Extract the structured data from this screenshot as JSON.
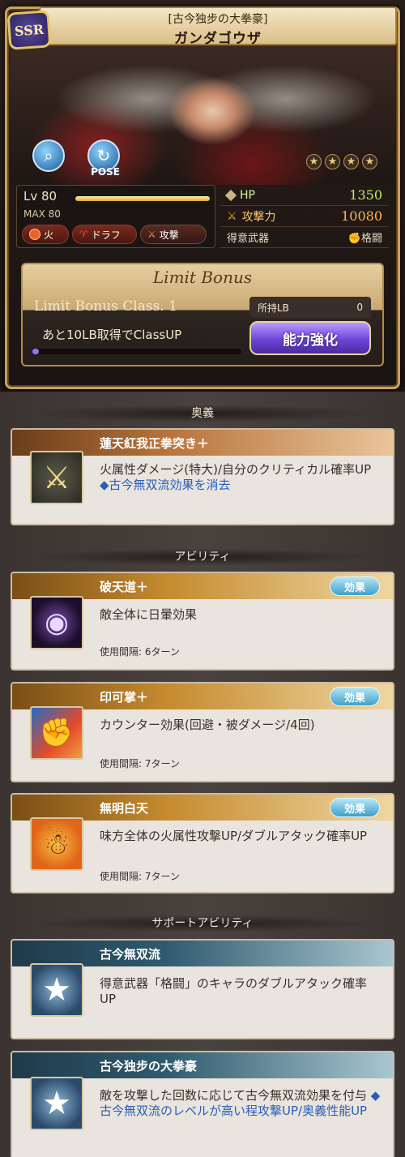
{
  "character": {
    "rarity": "SSR",
    "subtitle": "[古今独步の大拳豪]",
    "name": "ガンダゴウザ",
    "pose_label": "POSE",
    "stars": [
      "★",
      "★",
      "★",
      "★"
    ]
  },
  "level": {
    "label": "Lv 80",
    "max": "MAX 80",
    "element": "火",
    "race": "ドラフ",
    "type": "攻撃"
  },
  "stats": {
    "hp_label": "HP",
    "hp": "1350",
    "atk_label": "攻撃力",
    "atk": "10080",
    "weapon_label": "得意武器",
    "weapon": "格闘"
  },
  "limit_bonus": {
    "title": "Limit Bonus",
    "class": "Limit Bonus Class. 1",
    "owned_label": "所持LB",
    "owned": "0",
    "remaining": "あと10LB取得でClassUP",
    "button": "能力強化",
    "progress": 0.03
  },
  "sections": {
    "ougi": "奥義",
    "abilities": "アビリティ",
    "support": "サポートアビリティ"
  },
  "ougi": {
    "name": "蓮天紅我正拳突き＋",
    "desc": "火属性ダメージ(特大)/自分のクリティカル確率UP",
    "desc_blue": "◆古今無双流効果を消去"
  },
  "abilities": [
    {
      "name": "破天道＋",
      "effect_button": "効果",
      "desc": "敵全体に日暈効果",
      "cooldown": "使用間隔: 6ターン"
    },
    {
      "name": "印可掌＋",
      "effect_button": "効果",
      "desc": "カウンター効果(回避・被ダメージ/4回)",
      "cooldown": "使用間隔: 7ターン"
    },
    {
      "name": "無明白天",
      "effect_button": "効果",
      "desc": "味方全体の火属性攻撃UP/ダブルアタック確率UP",
      "cooldown": "使用間隔: 7ターン"
    }
  ],
  "support": [
    {
      "name": "古今無双流",
      "desc": "得意武器「格闘」のキャラのダブルアタック確率UP",
      "desc_blue": ""
    },
    {
      "name": "古今独步の大拳豪",
      "desc": "敵を攻撃した回数に応じて古今無双流効果を付与",
      "desc_blue": "◆古今無双流のレベルが高い程攻撃UP/奥義性能UP"
    }
  ],
  "colors": {
    "gold": "#c9a35a",
    "hp": "#b7ec6a",
    "atk": "#ffb35a",
    "limit_button": "#6d45d8",
    "effect_button": "#3e9fc8",
    "blue_text": "#2a5eb8"
  },
  "icons": {
    "zoom": "magnifier-icon",
    "pose": "rotate-icon",
    "fire": "fire-element-icon",
    "race": "draph-horn-icon",
    "type": "attack-type-icon",
    "hp": "diamond-icon",
    "atk": "sword-icon",
    "weapon": "fist-icon",
    "ougi": "crossed-swords-icon",
    "ability1": "eye-icon",
    "ability2": "fist-counter-icon",
    "ability3": "meditation-icon",
    "support": "star-icon"
  }
}
